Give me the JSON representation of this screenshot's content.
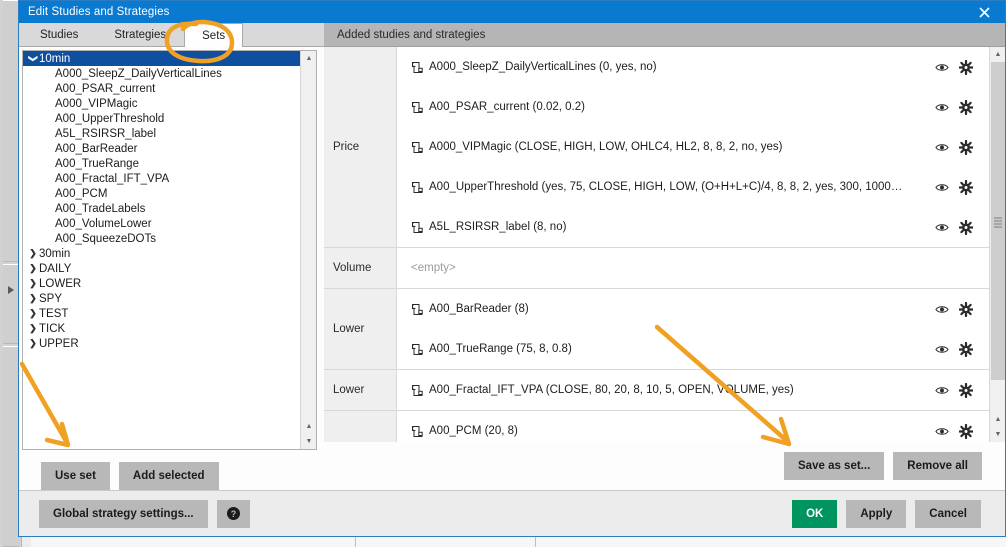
{
  "window": {
    "title": "Edit Studies and Strategies",
    "close_icon": "close-icon"
  },
  "tabs": [
    {
      "label": "Studies",
      "active": false
    },
    {
      "label": "Strategies",
      "active": false
    },
    {
      "label": "Sets",
      "active": true
    }
  ],
  "tree": {
    "nodes": [
      {
        "label": "10min",
        "type": "group",
        "expanded": true,
        "selected": true,
        "chevron": "chevron-down-icon"
      },
      {
        "label": "A000_SleepZ_DailyVerticalLines",
        "type": "leaf"
      },
      {
        "label": "A00_PSAR_current",
        "type": "leaf"
      },
      {
        "label": "A000_VIPMagic",
        "type": "leaf"
      },
      {
        "label": "A00_UpperThreshold",
        "type": "leaf"
      },
      {
        "label": "A5L_RSIRSR_label",
        "type": "leaf"
      },
      {
        "label": "A00_BarReader",
        "type": "leaf"
      },
      {
        "label": "A00_TrueRange",
        "type": "leaf"
      },
      {
        "label": "A00_Fractal_IFT_VPA",
        "type": "leaf"
      },
      {
        "label": "A00_PCM",
        "type": "leaf"
      },
      {
        "label": "A00_TradeLabels",
        "type": "leaf"
      },
      {
        "label": "A00_VolumeLower",
        "type": "leaf"
      },
      {
        "label": "A00_SqueezeDOTs",
        "type": "leaf"
      },
      {
        "label": "30min",
        "type": "group",
        "expanded": false,
        "selected": false,
        "chevron": "chevron-right-icon"
      },
      {
        "label": "DAILY",
        "type": "group",
        "expanded": false,
        "selected": false,
        "chevron": "chevron-right-icon"
      },
      {
        "label": "LOWER",
        "type": "group",
        "expanded": false,
        "selected": false,
        "chevron": "chevron-right-icon"
      },
      {
        "label": "SPY",
        "type": "group",
        "expanded": false,
        "selected": false,
        "chevron": "chevron-right-icon"
      },
      {
        "label": "TEST",
        "type": "group",
        "expanded": false,
        "selected": false,
        "chevron": "chevron-right-icon"
      },
      {
        "label": "TICK",
        "type": "group",
        "expanded": false,
        "selected": false,
        "chevron": "chevron-right-icon"
      },
      {
        "label": "UPPER",
        "type": "group",
        "expanded": false,
        "selected": false,
        "chevron": "chevron-right-icon"
      }
    ]
  },
  "left_buttons": [
    {
      "label": "Use set",
      "name": "use-set-button"
    },
    {
      "label": "Add selected",
      "name": "add-selected-button"
    }
  ],
  "added_panel": {
    "header": "Added studies and strategies",
    "groups": [
      {
        "label": "Price",
        "rows": [
          {
            "text": "A000_SleepZ_DailyVerticalLines (0, yes, no)",
            "empty": false
          },
          {
            "text": "A00_PSAR_current (0.02, 0.2)",
            "empty": false
          },
          {
            "text": "A000_VIPMagic (CLOSE, HIGH, LOW, OHLC4, HL2, 8, 8, 2, no, yes)",
            "empty": false
          },
          {
            "text": "A00_UpperThreshold (yes, 75, CLOSE, HIGH, LOW, (O+H+L+C)/4, 8, 8, 2, yes, 300, 1000…",
            "empty": false
          },
          {
            "text": "A5L_RSIRSR_label (8, no)",
            "empty": false
          }
        ]
      },
      {
        "label": "Volume",
        "rows": [
          {
            "text": "<empty>",
            "empty": true
          }
        ]
      },
      {
        "label": "Lower",
        "rows": [
          {
            "text": "A00_BarReader (8)",
            "empty": false
          },
          {
            "text": "A00_TrueRange (75, 8, 0.8)",
            "empty": false
          }
        ]
      },
      {
        "label": "Lower",
        "rows": [
          {
            "text": "A00_Fractal_IFT_VPA (CLOSE, 80, 20, 8, 10, 5, OPEN, VOLUME, yes)",
            "empty": false
          }
        ]
      },
      {
        "label": "",
        "rows": [
          {
            "text": "A00_PCM (20, 8)",
            "empty": false
          }
        ]
      }
    ],
    "row_icons": {
      "study": "study-icon",
      "visibility": "eye-icon",
      "settings": "gear-icon"
    }
  },
  "right_buttons": [
    {
      "label": "Save as set...",
      "name": "save-as-set-button"
    },
    {
      "label": "Remove all",
      "name": "remove-all-button"
    }
  ],
  "footer": {
    "global_settings_label": "Global strategy settings...",
    "help_icon": "help-icon",
    "ok_label": "OK",
    "apply_label": "Apply",
    "cancel_label": "Cancel"
  },
  "colors": {
    "titlebar": "#0a7ad1",
    "accent_ok": "#00945e",
    "selection": "#0f4f9e",
    "annotation": "#f0a023",
    "button_face": "#b8b8b8",
    "header_gray": "#b5b5b5"
  },
  "annotations": {
    "circle_target": "Sets",
    "arrow_1_target": "Use set",
    "arrow_2_target": "Save as set..."
  }
}
